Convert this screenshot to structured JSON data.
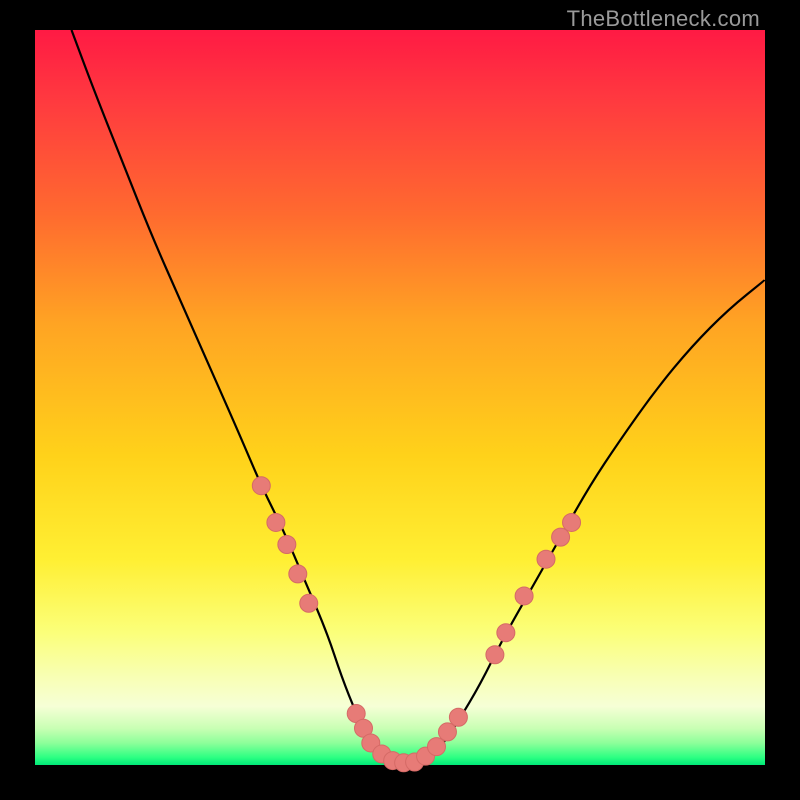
{
  "watermark": "TheBottleneck.com",
  "colors": {
    "frame": "#000000",
    "curve": "#000000",
    "dot_fill": "#e77b77",
    "dot_stroke": "#d56a66"
  },
  "chart_data": {
    "type": "line",
    "title": "",
    "xlabel": "",
    "ylabel": "",
    "xlim": [
      0,
      100
    ],
    "ylim": [
      0,
      100
    ],
    "series": [
      {
        "name": "bottleneck-curve",
        "x": [
          5,
          8,
          12,
          16,
          20,
          24,
          28,
          31,
          34,
          37,
          40,
          42,
          44,
          46,
          48,
          50,
          52,
          54,
          56,
          58,
          61,
          64,
          68,
          72,
          76,
          80,
          85,
          90,
          95,
          100
        ],
        "y": [
          100,
          92,
          82,
          72,
          63,
          54,
          45,
          38,
          32,
          25,
          18,
          12,
          7,
          3,
          1,
          0.3,
          0.3,
          1,
          3,
          6,
          11,
          17,
          24,
          31,
          38,
          44,
          51,
          57,
          62,
          66
        ]
      }
    ],
    "markers": {
      "name": "highlighted-points",
      "points": [
        {
          "x": 31,
          "y": 38
        },
        {
          "x": 33,
          "y": 33
        },
        {
          "x": 34.5,
          "y": 30
        },
        {
          "x": 36,
          "y": 26
        },
        {
          "x": 37.5,
          "y": 22
        },
        {
          "x": 44,
          "y": 7
        },
        {
          "x": 45,
          "y": 5
        },
        {
          "x": 46,
          "y": 3
        },
        {
          "x": 47.5,
          "y": 1.5
        },
        {
          "x": 49,
          "y": 0.6
        },
        {
          "x": 50.5,
          "y": 0.3
        },
        {
          "x": 52,
          "y": 0.4
        },
        {
          "x": 53.5,
          "y": 1.2
        },
        {
          "x": 55,
          "y": 2.5
        },
        {
          "x": 56.5,
          "y": 4.5
        },
        {
          "x": 58,
          "y": 6.5
        },
        {
          "x": 63,
          "y": 15
        },
        {
          "x": 64.5,
          "y": 18
        },
        {
          "x": 67,
          "y": 23
        },
        {
          "x": 70,
          "y": 28
        },
        {
          "x": 72,
          "y": 31
        },
        {
          "x": 73.5,
          "y": 33
        }
      ]
    }
  }
}
